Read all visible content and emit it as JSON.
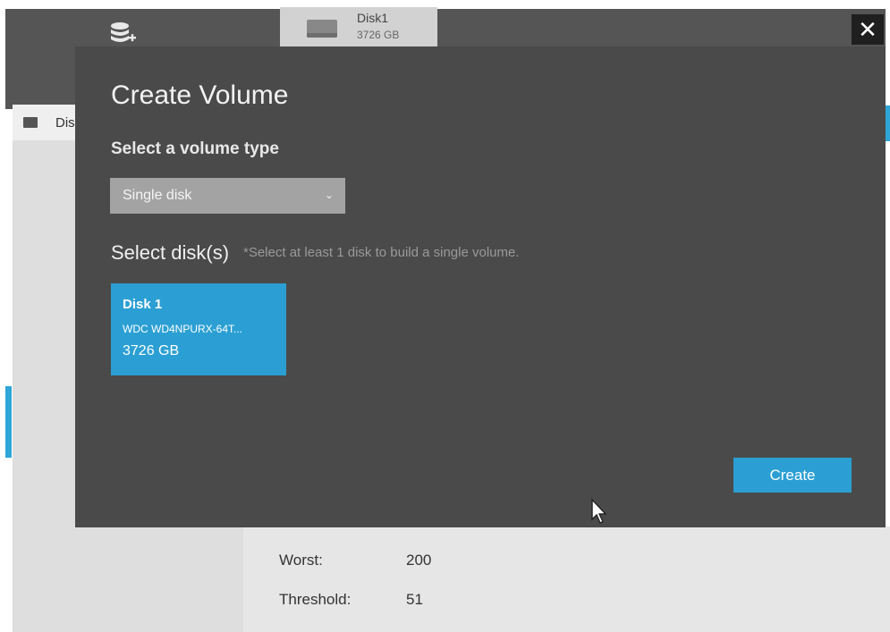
{
  "background": {
    "disk_tab": {
      "name": "Disk1",
      "size": "3726 GB"
    },
    "close_label": "✕",
    "left_list": {
      "item_label": "Dis"
    },
    "stats": [
      {
        "label": "Worst:",
        "value": "200"
      },
      {
        "label": "Threshold:",
        "value": "51"
      }
    ]
  },
  "modal": {
    "icon": "database-add-icon",
    "title": "Create Volume",
    "volume_type_label": "Select a volume type",
    "volume_type_value": "Single disk",
    "disks_label": "Select disk(s)",
    "disks_hint": "*Select at least 1 disk to build a single volume.",
    "disk": {
      "name": "Disk 1",
      "model": "WDC WD4NPURX-64T...",
      "size": "3726 GB"
    },
    "create_label": "Create"
  },
  "colors": {
    "accent": "#2b9fd3",
    "modal_bg": "#4a4a4a",
    "select_bg": "#a3a3a3"
  }
}
